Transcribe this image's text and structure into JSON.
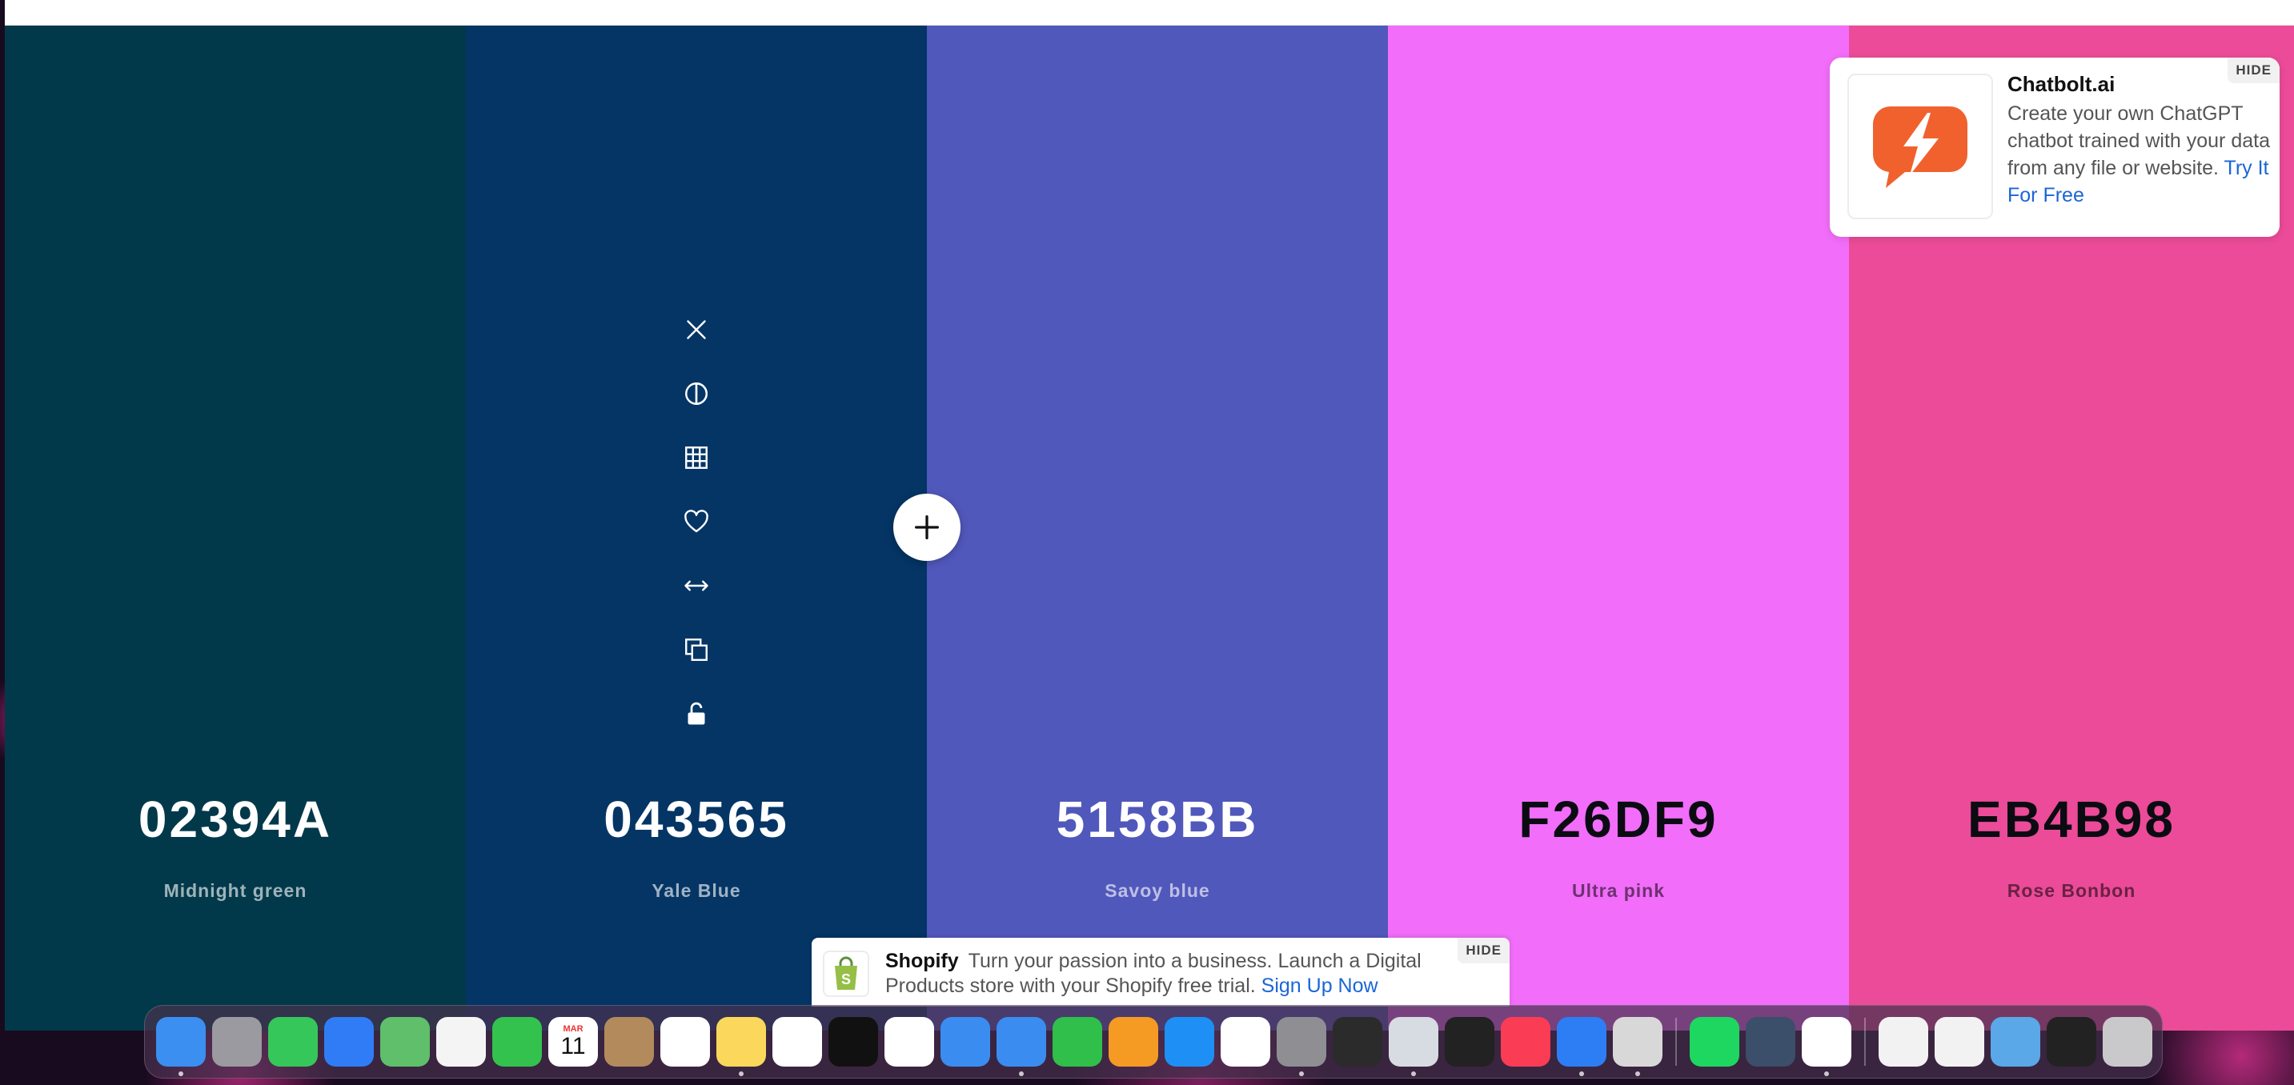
{
  "palette": {
    "colors": [
      {
        "hex": "02394A",
        "name": "Midnight green",
        "swatch": "#02394A",
        "tone": "light"
      },
      {
        "hex": "043565",
        "name": "Yale Blue",
        "swatch": "#043565",
        "tone": "light"
      },
      {
        "hex": "5158BB",
        "name": "Savoy blue",
        "swatch": "#5158BB",
        "tone": "light"
      },
      {
        "hex": "F26DF9",
        "name": "Ultra pink",
        "swatch": "#F26DF9",
        "tone": "dark"
      },
      {
        "hex": "EB4B98",
        "name": "Rose Bonbon",
        "swatch": "#EB4B98",
        "tone": "dark"
      }
    ],
    "tools": [
      "close-icon",
      "contrast-icon",
      "shades-grid-icon",
      "heart-icon",
      "drag-arrows-icon",
      "copy-icon",
      "unlock-icon"
    ]
  },
  "ad_card": {
    "title": "Chatbolt.ai",
    "body": "Create your own ChatGPT chatbot trained with your data from any file or website.",
    "link": "Try It For Free",
    "hide": "HIDE",
    "accent": "#F0612E"
  },
  "banner": {
    "title": "Shopify",
    "body": "Turn your passion into a business. Launch a Digital Products store with your Shopify free trial.",
    "link": "Sign Up Now",
    "hide": "HIDE",
    "accent": "#95BF47"
  },
  "dock": {
    "calendar_month": "MAR",
    "calendar_day": "11",
    "apps": [
      {
        "name": "finder",
        "color": "#3b8ff0"
      },
      {
        "name": "launchpad",
        "color": "#9a9aa0"
      },
      {
        "name": "messages",
        "color": "#35c759"
      },
      {
        "name": "mail",
        "color": "#2f7cf6"
      },
      {
        "name": "maps",
        "color": "#5fbf6a"
      },
      {
        "name": "photos",
        "color": "#f4f4f4"
      },
      {
        "name": "facetime",
        "color": "#33c24d"
      },
      {
        "name": "calendar",
        "color": "#ffffff"
      },
      {
        "name": "contacts",
        "color": "#b38a5c"
      },
      {
        "name": "reminders",
        "color": "#ffffff"
      },
      {
        "name": "notes",
        "color": "#fbd75b"
      },
      {
        "name": "freeform",
        "color": "#ffffff"
      },
      {
        "name": "apple-tv",
        "color": "#111111"
      },
      {
        "name": "news",
        "color": "#ffffff"
      },
      {
        "name": "keynote",
        "color": "#3a8cf0"
      },
      {
        "name": "safari",
        "color": "#3a8cf0"
      },
      {
        "name": "numbers",
        "color": "#2fbf4a"
      },
      {
        "name": "pages",
        "color": "#f59a23"
      },
      {
        "name": "app-store",
        "color": "#1e90f5"
      },
      {
        "name": "chrome",
        "color": "#ffffff"
      },
      {
        "name": "system-settings",
        "color": "#8e8e93"
      },
      {
        "name": "blender",
        "color": "#2b2b2b"
      },
      {
        "name": "preview",
        "color": "#d7dbe2"
      },
      {
        "name": "unity",
        "color": "#222222"
      },
      {
        "name": "music",
        "color": "#fa3c55"
      },
      {
        "name": "xcode",
        "color": "#2d7ef5"
      },
      {
        "name": "roblox",
        "color": "#d8d8d8"
      },
      {
        "name": "spotify",
        "color": "#1ed760"
      },
      {
        "name": "preview-2",
        "color": "#3b4e6a"
      },
      {
        "name": "nordvpn",
        "color": "#ffffff"
      },
      {
        "name": "jpeg-file",
        "color": "#f2f2f2"
      },
      {
        "name": "jpeg-file-2",
        "color": "#f2f2f2"
      },
      {
        "name": "downloads-folder",
        "color": "#5aa8e8"
      },
      {
        "name": "terminal-window",
        "color": "#222222"
      },
      {
        "name": "trash",
        "color": "#c9c9cc"
      }
    ]
  }
}
